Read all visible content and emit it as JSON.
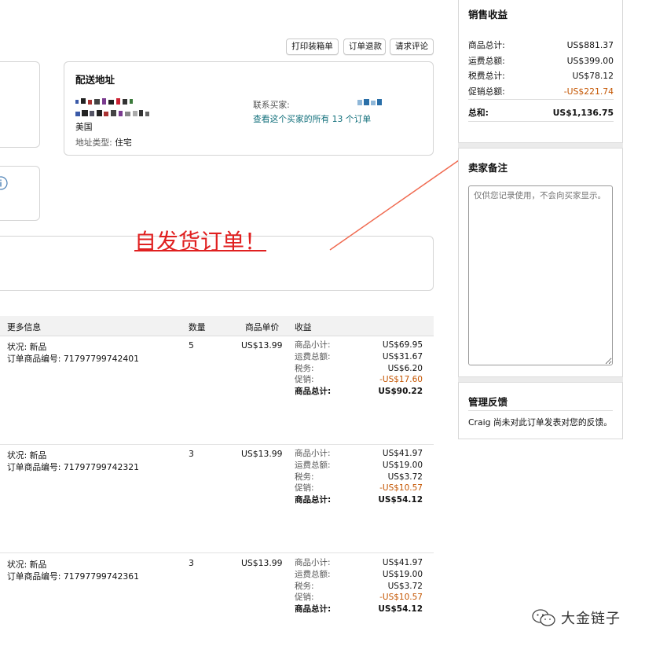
{
  "toolbar": {
    "print_label": "打印装箱单",
    "refund_label": "订单退款",
    "review_label": "请求评论"
  },
  "shipping": {
    "title": "配送地址",
    "country": "美国",
    "address_type_label": "地址类型:",
    "address_type_value": "住宅",
    "contact_label": "联系买家:",
    "all_orders_link": "查看这个买家的所有 13 个订单"
  },
  "annotation": {
    "text": "自发货订单！",
    "color": "#e02020",
    "arrow_color": "#f06a50"
  },
  "items_table": {
    "headers": [
      "更多信息",
      "数量",
      "商品单价",
      "收益"
    ],
    "rows": [
      {
        "condition": "状况: 新品",
        "item_id": "订单商品编号: 71797799742401",
        "qty": "5",
        "unit_price": "US$13.99",
        "revenue": [
          {
            "label": "商品小计:",
            "value": "US$69.95"
          },
          {
            "label": "运费总额:",
            "value": "US$31.67"
          },
          {
            "label": "税务:",
            "value": "US$6.20"
          },
          {
            "label": "促销:",
            "value": "-US$17.60"
          },
          {
            "label": "商品总计:",
            "value": "US$90.22"
          }
        ]
      },
      {
        "condition": "状况: 新品",
        "item_id": "订单商品编号: 71797799742321",
        "qty": "3",
        "unit_price": "US$13.99",
        "revenue": [
          {
            "label": "商品小计:",
            "value": "US$41.97"
          },
          {
            "label": "运费总额:",
            "value": "US$19.00"
          },
          {
            "label": "税务:",
            "value": "US$3.72"
          },
          {
            "label": "促销:",
            "value": "-US$10.57"
          },
          {
            "label": "商品总计:",
            "value": "US$54.12"
          }
        ]
      },
      {
        "condition": "状况: 新品",
        "item_id": "订单商品编号: 71797799742361",
        "qty": "3",
        "unit_price": "US$13.99",
        "revenue": [
          {
            "label": "商品小计:",
            "value": "US$41.97"
          },
          {
            "label": "运费总额:",
            "value": "US$19.00"
          },
          {
            "label": "税务:",
            "value": "US$3.72"
          },
          {
            "label": "促销:",
            "value": "-US$10.57"
          },
          {
            "label": "商品总计:",
            "value": "US$54.12"
          }
        ]
      }
    ]
  },
  "sales_summary": {
    "title": "销售收益",
    "rows": [
      {
        "label": "商品总计:",
        "value": "US$881.37"
      },
      {
        "label": "运费总额:",
        "value": "US$399.00"
      },
      {
        "label": "税费总计:",
        "value": "US$78.12"
      },
      {
        "label": "促销总额:",
        "value": "-US$221.74"
      }
    ],
    "total_label": "总和:",
    "total_value": "US$1,136.75"
  },
  "seller_notes": {
    "title": "卖家备注",
    "placeholder": "仅供您记录使用，不会向买家显示。"
  },
  "feedback": {
    "title": "管理反馈",
    "text": "Craig 尚未对此订单发表对您的反馈。"
  },
  "watermark": {
    "text": "大金链子"
  },
  "colors": {
    "link": "#0f6e7a",
    "promo": "#c45500"
  }
}
